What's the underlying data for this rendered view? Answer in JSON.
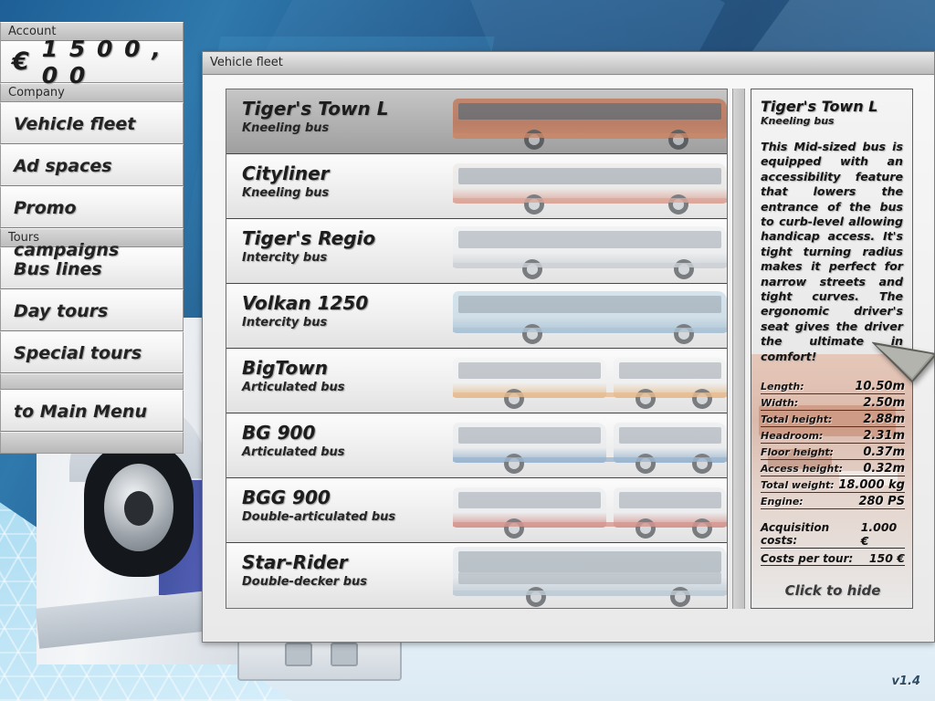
{
  "background": {
    "accent_blue": "#1d5f96",
    "hex_panel": "#a9dcf2"
  },
  "sidebar": {
    "account_header": "Account",
    "account_currency": "€",
    "account_balance": "1 5 0 0 , 0 0",
    "company_header": "Company",
    "company_items": [
      {
        "label": "Vehicle fleet",
        "name": "vehicle-fleet"
      },
      {
        "label": "Ad spaces",
        "name": "ad-spaces"
      },
      {
        "label": "Promo campaigns",
        "name": "promo-campaigns"
      }
    ],
    "tours_header": "Tours",
    "tours_items": [
      {
        "label": "Bus lines",
        "name": "bus-lines"
      },
      {
        "label": "Day tours",
        "name": "day-tours"
      },
      {
        "label": "Special tours",
        "name": "special-tours"
      }
    ],
    "main_menu_label": "to Main Menu"
  },
  "window": {
    "title": "Vehicle fleet"
  },
  "fleet": {
    "rows": [
      {
        "name": "Tiger's Town L",
        "type": "Kneeling bus",
        "selected": true,
        "thumb": {
          "body": "#c2572a",
          "glass": "#2b3440",
          "accent": "#e0703d",
          "style": "city"
        }
      },
      {
        "name": "Cityliner",
        "type": "Kneeling bus",
        "selected": false,
        "thumb": {
          "body": "#e8e6e2",
          "glass": "#7d8894",
          "accent": "#d4705a",
          "style": "city"
        }
      },
      {
        "name": "Tiger's Regio",
        "type": "Intercity bus",
        "selected": false,
        "thumb": {
          "body": "#eceef0",
          "glass": "#8d98a4",
          "accent": "#b8c0c8",
          "style": "coach"
        }
      },
      {
        "name": "Volkan 1250",
        "type": "Intercity bus",
        "selected": false,
        "thumb": {
          "body": "#b9d2e4",
          "glass": "#6f8596",
          "accent": "#7aa6c6",
          "style": "coach"
        }
      },
      {
        "name": "BigTown",
        "type": "Articulated bus",
        "selected": false,
        "thumb": {
          "body": "#f0f1f2",
          "glass": "#8e98a2",
          "accent": "#e39a4e",
          "style": "artic"
        }
      },
      {
        "name": "BG 900",
        "type": "Articulated bus",
        "selected": false,
        "thumb": {
          "body": "#e8eaec",
          "glass": "#8794a0",
          "accent": "#5d8fbf",
          "style": "artic"
        }
      },
      {
        "name": "BGG 900",
        "type": "Double-articulated bus",
        "selected": false,
        "thumb": {
          "body": "#ebecee",
          "glass": "#8b96a1",
          "accent": "#c4554a",
          "style": "artic"
        }
      },
      {
        "name": "Star-Rider",
        "type": "Double-decker bus",
        "selected": false,
        "thumb": {
          "body": "#dfe6ec",
          "glass": "#7e8d9a",
          "accent": "#9fb7c8",
          "style": "decker"
        }
      }
    ]
  },
  "info": {
    "title": "Tiger's Town L",
    "subtitle": "Kneeling bus",
    "description": "This Mid-sized bus is equipped with an accessibility feature that lowers the entrance of the bus to curb-level allowing handicap access. It's tight turning radius makes it perfect for narrow streets and tight curves. The ergonomic driver's seat gives the driver the ultimate in comfort!",
    "specs": [
      {
        "key": "Length:",
        "value": "10.50m"
      },
      {
        "key": "Width:",
        "value": "2.50m"
      },
      {
        "key": "Total height:",
        "value": "2.88m"
      },
      {
        "key": "Headroom:",
        "value": "2.31m"
      },
      {
        "key": "Floor height:",
        "value": "0.37m"
      },
      {
        "key": "Access height:",
        "value": "0.32m"
      },
      {
        "key": "Total weight:",
        "value": "18.000 kg"
      },
      {
        "key": "Engine:",
        "value": "280 PS"
      }
    ],
    "costs": [
      {
        "key": "Acquisition costs:",
        "value": "1.000 €"
      },
      {
        "key": "Costs per tour:",
        "value": "150 €"
      }
    ],
    "hide_label": "Click to hide"
  },
  "footer": {
    "version": "v1.4"
  }
}
